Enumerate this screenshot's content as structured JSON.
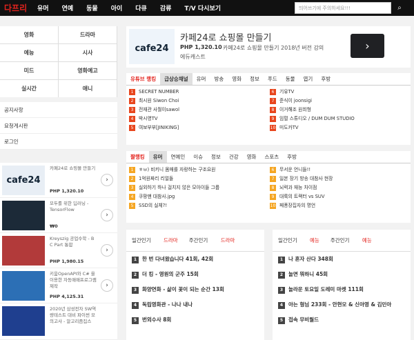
{
  "header": {
    "logo": "다프리",
    "nav": [
      "유머",
      "연예",
      "동물",
      "아이",
      "다큐",
      "감류",
      "T/V 다시보기"
    ],
    "search_placeholder": "띄어쓰기에 주의하세요!!!",
    "search_icon": "search-icon"
  },
  "sidebar": {
    "menu": [
      "영화",
      "드라마",
      "예능",
      "시사",
      "미드",
      "영화예고",
      "실시간",
      "애니"
    ],
    "links": [
      "공지사항",
      "요청게시판",
      "로그인"
    ]
  },
  "ads": [
    {
      "title": "카페24로 쇼핑몰 만들기",
      "price": "PHP 1,320.10",
      "thumb": "cafe24"
    },
    {
      "title": "모두를 위한 딥러닝 - TensorFlow",
      "price": "₩0",
      "thumb": ""
    },
    {
      "title": "Kreyszig 공업수학 - B C Part 통합",
      "price": "PHP 1,980.15",
      "thumb": ""
    },
    {
      "title": "키움OpenAPI와 C# 을 이용한 자동매매프로그램 제작",
      "price": "PHP 4,125.31",
      "thumb": ""
    },
    {
      "title": "2020년 삼성전자 SW역량테스트 대비 파이썬 모의고사 - 알고리즘집스",
      "price": "",
      "thumb": ""
    }
  ],
  "banner": {
    "title": "카페24로 쇼핑몰 만들기",
    "price": "PHP 1,320.10",
    "desc": "카페24로 쇼핑몰 만들기 2018년 버전 강의",
    "desc2": "에듀캐스트",
    "brand": "cafe24",
    "arrow": "›"
  },
  "youtube": {
    "tabs": [
      "유튜브 랭킹",
      "급상승채널",
      "유머",
      "방송",
      "영화",
      "정보",
      "푸드",
      "동물",
      "엽기",
      "후방"
    ],
    "items": [
      "SECRET NUMBER",
      "기유TV",
      "최시원 Siwon Choi",
      "준식이 joonsigi",
      "전재관 사월이sawol",
      "이거해조 원희형",
      "박시영TV",
      "임펄 스튜디오 / DUM DUM STUDIO",
      "여보부부[JINIKING]",
      "미도카TV"
    ]
  },
  "hot": {
    "tabs": [
      "짤랭킹",
      "유머",
      "연예인",
      "이슈",
      "정보",
      "건강",
      "영화",
      "스포츠",
      "후방"
    ],
    "items": [
      "ㅎㅂ) 비키니 몸매를 자랑하는 구조요원",
      "무서운 언니들!!",
      "1억원짜리 리얼돌",
      "일본 장기 방송 대참사 현장",
      "실외하기 하나 걸치지 않은 모아이들 그룹",
      "뇌력과 재능 차이점",
      "쿠팡맨 대참사.jpg",
      "대륙의 트랙터 vs SUV",
      "SSD의 실체?!",
      "페퐁장집자의 명언"
    ]
  },
  "drama": {
    "tabs": [
      "일간인기",
      "드라마",
      "주간인기",
      "드라마"
    ],
    "items": [
      "한 번 다녀왔습니다 41회, 42회",
      "더 킹 - 영원의 군주 15회",
      "화양연화 - 삶이 꽃이 되는 순간 13회",
      "독립영화관 - 나나 내나",
      "번외수사 8회"
    ]
  },
  "variety": {
    "tabs": [
      "일간인기",
      "예능",
      "주간인기",
      "예능"
    ],
    "items": [
      "나 혼자 산다 348회",
      "놀면 뭐하니 45회",
      "놀라운 토요일 도레미 마켓 111회",
      "아는 형님 233회 - 안현모 & 신아영 & 김민아",
      "접속 무비월드"
    ]
  },
  "colors": {
    "accent": "#e3231d",
    "rank_red": "#e8451c",
    "rank_orange": "#f5a623"
  }
}
